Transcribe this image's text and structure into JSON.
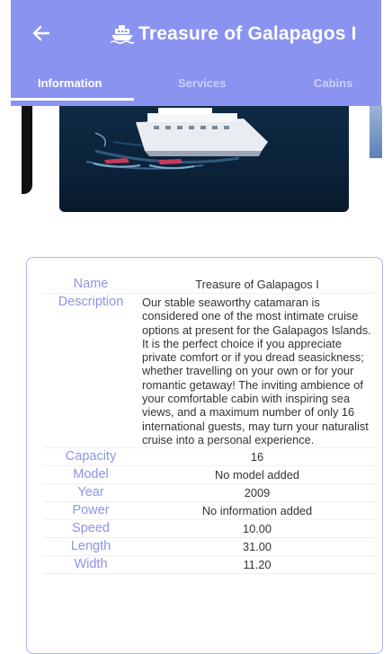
{
  "header": {
    "title": "Treasure of Galapagos I",
    "back_icon": "arrow-left-icon",
    "title_icon": "ship-icon",
    "background_color": "#8a93f0"
  },
  "tabs": [
    {
      "label": "Information",
      "active": true
    },
    {
      "label": "Services",
      "active": false
    },
    {
      "label": "Cabins",
      "active": false
    }
  ],
  "details": {
    "name_label": "Name",
    "name_value": "Treasure of Galapagos I",
    "description_label": "Description",
    "description_value": "Our stable seaworthy catamaran is considered one of the most intimate cruise options at present for the Galapagos Islands. It is the perfect choice if you appreciate private comfort or if you dread seasickness; whether travelling on your own or for your romantic getaway! The inviting ambience of your comfortable cabin with inspiring sea views, and a maximum number of only 16 international guests, may turn your naturalist cruise into a personal experience.",
    "capacity_label": "Capacity",
    "capacity_value": "16",
    "model_label": "Model",
    "model_value": "No model added",
    "year_label": "Year",
    "year_value": "2009",
    "power_label": "Power",
    "power_value": "No information added",
    "speed_label": "Speed",
    "speed_value": "10.00",
    "length_label": "Length",
    "length_value": "31.00",
    "width_label": "Width",
    "width_value": "11.20"
  }
}
